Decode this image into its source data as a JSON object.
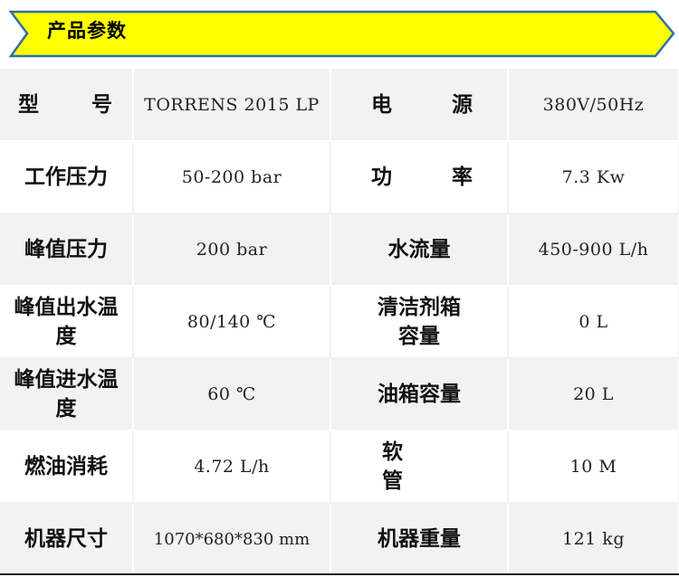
{
  "banner": {
    "title": "产品参数",
    "fill_color": "#ffff00",
    "stroke_color": "#2f6fa8"
  },
  "specs": [
    {
      "label_left": "型　　号",
      "value_left": "TORRENS 2015 LP",
      "label_right": "电　　源",
      "value_right": "380V/50Hz"
    },
    {
      "label_left": "工作压力",
      "value_left": "50-200 bar",
      "label_right": "功　　率",
      "value_right": "7.3 Kw"
    },
    {
      "label_left": "峰值压力",
      "value_left": "200 bar",
      "label_right": "水流量",
      "value_right": "450-900 L/h"
    },
    {
      "label_left": "峰值出水温度",
      "value_left": "80/140 ℃",
      "label_right": "清洁剂箱容量",
      "value_right": "0 L"
    },
    {
      "label_left": "峰值进水温度",
      "value_left": "60 ℃",
      "label_right": "油箱容量",
      "value_right": "20 L"
    },
    {
      "label_left": "燃油消耗",
      "value_left": "4.72 L/h",
      "label_right": "软　　管",
      "value_right": "10 M"
    },
    {
      "label_left": "机器尺寸",
      "value_left": "1070*680*830 mm",
      "label_right": "机器重量",
      "value_right": "121 kg"
    }
  ]
}
